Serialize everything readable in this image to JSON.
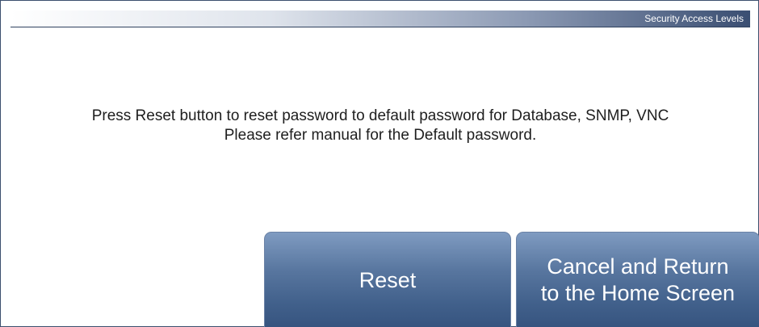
{
  "header": {
    "title": "Security Access Levels"
  },
  "message": {
    "line1": "Press Reset button to reset password to default password for Database, SNMP, VNC",
    "line2": "Please refer manual for the Default password."
  },
  "buttons": {
    "reset_label": "Reset",
    "cancel_label_line1": "Cancel and Return",
    "cancel_label_line2": "to the Home Screen"
  },
  "colors": {
    "button_top": "#7f9bc1",
    "button_bottom": "#36547f",
    "header_dark": "#3a4e72"
  }
}
